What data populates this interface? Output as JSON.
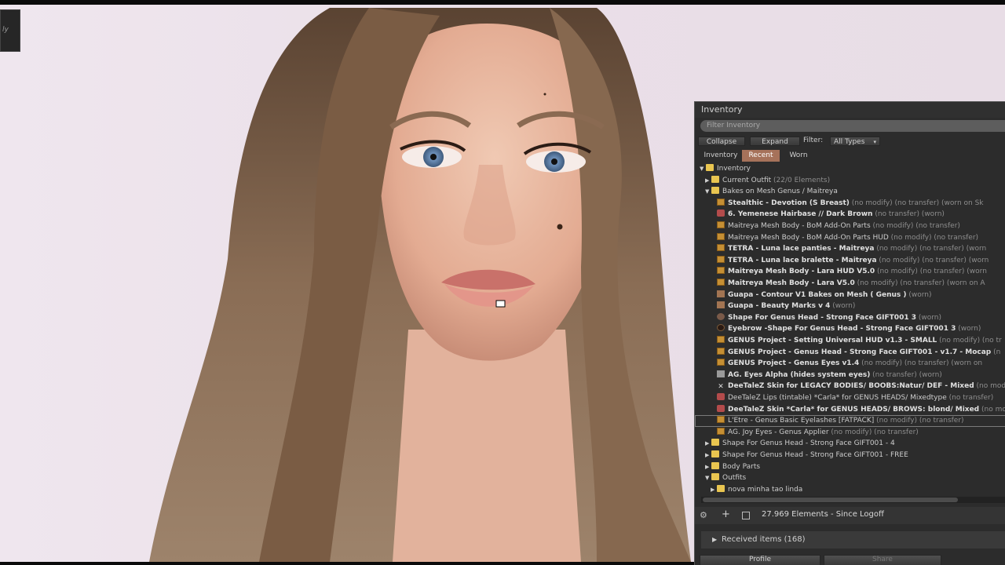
{
  "logo": {
    "text": "ly"
  },
  "inventory": {
    "title": "Inventory",
    "filter_placeholder": "Filter Inventory",
    "collapse_label": "Collapse",
    "expand_label": "Expand",
    "filter_label": "Filter:",
    "filter_value": "All Types",
    "tabs": [
      "Inventory",
      "Recent",
      "Worn"
    ],
    "active_tab": "Recent",
    "rows": [
      {
        "indent": 0,
        "tri": "▼",
        "icon": "folder",
        "name": "Inventory",
        "suffix": "",
        "bold": false
      },
      {
        "indent": 1,
        "tri": "▶",
        "icon": "folder",
        "name": "Current Outfit",
        "suffix": " (22/0 Elements)",
        "bold": false
      },
      {
        "indent": 1,
        "tri": "▼",
        "icon": "folder",
        "name": "Bakes on Mesh  Genus / Maitreya",
        "suffix": "",
        "bold": false
      },
      {
        "indent": 2,
        "tri": "",
        "icon": "box",
        "name": "Stealthic - Devotion (S Breast)",
        "suffix": " (no modify) (no transfer) (worn on Sk",
        "bold": true
      },
      {
        "indent": 2,
        "tri": "",
        "icon": "skin",
        "name": "6. Yemenese Hairbase // Dark Brown",
        "suffix": " (no transfer) (worn)",
        "bold": true
      },
      {
        "indent": 2,
        "tri": "",
        "icon": "box",
        "name": "Maitreya Mesh Body - BoM Add-On Parts",
        "suffix": " (no modify) (no transfer)",
        "bold": false
      },
      {
        "indent": 2,
        "tri": "",
        "icon": "box",
        "name": "Maitreya Mesh Body - BoM Add-On Parts HUD",
        "suffix": " (no modify) (no transfer)",
        "bold": false
      },
      {
        "indent": 2,
        "tri": "",
        "icon": "box",
        "name": "TETRA - Luna lace panties - Maitreya",
        "suffix": " (no modify) (no transfer) (worn",
        "bold": true
      },
      {
        "indent": 2,
        "tri": "",
        "icon": "box",
        "name": "TETRA - Luna lace bralette - Maitreya",
        "suffix": " (no modify) (no transfer) (worn",
        "bold": true
      },
      {
        "indent": 2,
        "tri": "",
        "icon": "box",
        "name": "Maitreya Mesh Body - Lara HUD V5.0",
        "suffix": " (no modify) (no transfer) (worn",
        "bold": true
      },
      {
        "indent": 2,
        "tri": "",
        "icon": "box",
        "name": "Maitreya Mesh Body - Lara V5.0",
        "suffix": " (no modify) (no transfer) (worn on A",
        "bold": true
      },
      {
        "indent": 2,
        "tri": "",
        "icon": "body",
        "name": "Guapa - Contour V1 Bakes on Mesh ( Genus )",
        "suffix": " (worn)",
        "bold": true
      },
      {
        "indent": 2,
        "tri": "",
        "icon": "body",
        "name": "Guapa - Beauty Marks v 4",
        "suffix": " (worn)",
        "bold": true
      },
      {
        "indent": 2,
        "tri": "",
        "icon": "shape",
        "name": "Shape For Genus Head - Strong Face GIFT001 3",
        "suffix": " (worn)",
        "bold": true
      },
      {
        "indent": 2,
        "tri": "",
        "icon": "eye",
        "name": "Eyebrow -Shape For Genus Head - Strong Face GIFT001 3",
        "suffix": " (worn)",
        "bold": true
      },
      {
        "indent": 2,
        "tri": "",
        "icon": "box",
        "name": "GENUS Project - Setting Universal HUD v1.3 - SMALL",
        "suffix": " (no modify) (no tr",
        "bold": true
      },
      {
        "indent": 2,
        "tri": "",
        "icon": "box",
        "name": "GENUS Project - Genus Head - Strong Face GIFT001 - v1.7 - Mocap",
        "suffix": " (n",
        "bold": true
      },
      {
        "indent": 2,
        "tri": "",
        "icon": "box",
        "name": "GENUS Project - Genus Eyes v1.4",
        "suffix": " (no modify) (no transfer) (worn on",
        "bold": true
      },
      {
        "indent": 2,
        "tri": "",
        "icon": "alpha",
        "name": "AG. Eyes Alpha (hides system eyes)",
        "suffix": " (no transfer) (worn)",
        "bold": true
      },
      {
        "indent": 2,
        "tri": "",
        "icon": "person",
        "name": "DeeTaleZ Skin for LEGACY BODIES/ BOOBS:Natur/ DEF - Mixed",
        "suffix": " (no mod",
        "bold": true
      },
      {
        "indent": 2,
        "tri": "",
        "icon": "skin",
        "name": "DeeTaleZ Lips (tintable) *Carla* for GENUS HEADS/ Mixedtype",
        "suffix": " (no transfer)",
        "bold": false
      },
      {
        "indent": 2,
        "tri": "",
        "icon": "skin",
        "name": "DeeTaleZ Skin *Carla* for GENUS HEADS/ BROWS: blond/ Mixed",
        "suffix": " (no mod",
        "bold": true
      },
      {
        "indent": 2,
        "tri": "",
        "icon": "box",
        "name": "L'Etre - Genus Basic Eyelashes [FATPACK]",
        "suffix": " (no modify) (no transfer)",
        "bold": false,
        "selected": true
      },
      {
        "indent": 2,
        "tri": "",
        "icon": "box",
        "name": "AG. Joy Eyes - Genus Applier",
        "suffix": " (no modify) (no transfer)",
        "bold": false
      },
      {
        "indent": 1,
        "tri": "▶",
        "icon": "folder",
        "name": "Shape For Genus Head - Strong Face GIFT001 - 4",
        "suffix": "",
        "bold": false
      },
      {
        "indent": 1,
        "tri": "▶",
        "icon": "folder",
        "name": "Shape For Genus Head - Strong Face GIFT001 - FREE",
        "suffix": "",
        "bold": false
      },
      {
        "indent": 1,
        "tri": "▶",
        "icon": "folder",
        "name": "Body Parts",
        "suffix": "",
        "bold": false
      },
      {
        "indent": 1,
        "tri": "▼",
        "icon": "folder",
        "name": "Outfits",
        "suffix": "",
        "bold": false
      },
      {
        "indent": 2,
        "tri": "▶",
        "icon": "folder",
        "name": "nova minha tao linda",
        "suffix": "",
        "bold": false
      }
    ],
    "element_count": "27.969 Elements  - Since Logoff",
    "received_items": "Received items (168)",
    "bottom_buttons": [
      "Profile",
      "Share"
    ]
  },
  "colors": {
    "panel_bg": "#2c2c2c",
    "active_tab": "#a6725a",
    "background": "#eadfe8"
  }
}
